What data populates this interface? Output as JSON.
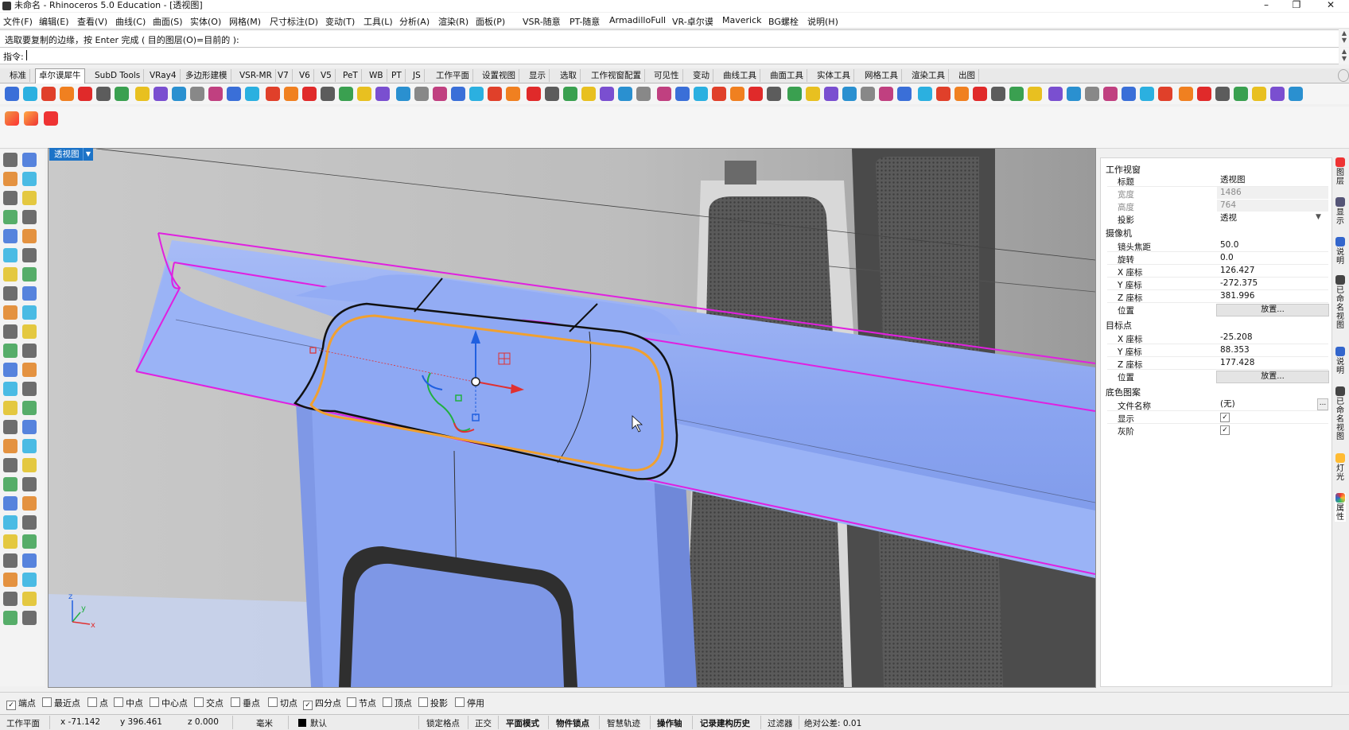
{
  "window": {
    "title": "未命名 - Rhinoceros 5.0 Education - [透视图]",
    "minimize": "–",
    "restore": "❐",
    "close": "✕"
  },
  "menu": [
    "文件(F)",
    "编辑(E)",
    "查看(V)",
    "曲线(C)",
    "曲面(S)",
    "实体(O)",
    "网格(M)",
    "尺寸标注(D)",
    "变动(T)",
    "工具(L)",
    "分析(A)",
    "渲染(R)",
    "面板(P)",
    "VSR-随意",
    "PT-随意",
    "ArmadilloFull",
    "VR-卓尔谟",
    "Maverick",
    "BG螺栓",
    "说明(H)"
  ],
  "command": {
    "prompt": "选取要复制的边缘，按 Enter 完成 ( 目的图层(O)=目前的 ):",
    "label": "指令:",
    "value": ""
  },
  "tabs": [
    "标准",
    "卓尔谟犀牛",
    "SubD Tools",
    "VRay4",
    "多边形建模",
    "VSR-MR",
    "V7",
    "V6",
    "V5",
    "PeT",
    "WB",
    "PT",
    "JS",
    "工作平面",
    "设置视图",
    "显示",
    "选取",
    "工作视窗配置",
    "可见性",
    "变动",
    "曲线工具",
    "曲面工具",
    "实体工具",
    "网格工具",
    "渲染工具",
    "出图"
  ],
  "active_tab": "卓尔谟犀牛",
  "viewport": {
    "label": "透视图",
    "axis_z": "z",
    "axis_y": "y",
    "axis_x": "x"
  },
  "properties": {
    "section_viewport": "工作视窗",
    "title_label": "标题",
    "title_value": "透视图",
    "width_label": "宽度",
    "width_value": "1486",
    "height_label": "高度",
    "height_value": "764",
    "projection_label": "投影",
    "projection_value": "透视",
    "section_camera": "摄像机",
    "lens_label": "镜头焦距",
    "lens_value": "50.0",
    "rotation_label": "旋转",
    "rotation_value": "0.0",
    "cam_x_label": "X 座标",
    "cam_x_value": "126.427",
    "cam_y_label": "Y 座标",
    "cam_y_value": "-272.375",
    "cam_z_label": "Z 座标",
    "cam_z_value": "381.996",
    "cam_pos_label": "位置",
    "cam_pos_button": "放置...",
    "section_target": "目标点",
    "tgt_x_label": "X 座标",
    "tgt_x_value": "-25.208",
    "tgt_y_label": "Y 座标",
    "tgt_y_value": "88.353",
    "tgt_z_label": "Z 座标",
    "tgt_z_value": "177.428",
    "tgt_pos_label": "位置",
    "tgt_pos_button": "放置...",
    "section_wallpaper": "底色图案",
    "file_label": "文件名称",
    "file_value": "(无)",
    "file_button": "...",
    "show_label": "显示",
    "show_checked": "✓",
    "gray_label": "灰阶",
    "gray_checked": "✓"
  },
  "right_tabs": [
    "图层",
    "显示",
    "说明",
    "已命名视图",
    "说明",
    "已命名视图",
    "灯光",
    "属性"
  ],
  "osnap": {
    "items": [
      {
        "label": "端点",
        "checked": "✓"
      },
      {
        "label": "最近点",
        "checked": ""
      },
      {
        "label": "点",
        "checked": ""
      },
      {
        "label": "中点",
        "checked": ""
      },
      {
        "label": "中心点",
        "checked": ""
      },
      {
        "label": "交点",
        "checked": ""
      },
      {
        "label": "垂点",
        "checked": ""
      },
      {
        "label": "切点",
        "checked": ""
      },
      {
        "label": "四分点",
        "checked": "✓"
      },
      {
        "label": "节点",
        "checked": ""
      },
      {
        "label": "顶点",
        "checked": ""
      },
      {
        "label": "投影",
        "checked": ""
      },
      {
        "label": "停用",
        "checked": ""
      }
    ]
  },
  "status": {
    "cplane": "工作平面",
    "x": "x -71.142",
    "y": "y 396.461",
    "z": "z 0.000",
    "units": "毫米",
    "layer": "默认",
    "grid_snap": "锁定格点",
    "ortho": "正交",
    "planar": "平面模式",
    "osnap": "物件锁点",
    "smarttrack": "智慧轨迹",
    "gumball": "操作轴",
    "history": "记录建构历史",
    "filter": "过滤器",
    "tolerance": "绝对公差: 0.01"
  },
  "colors": {
    "accent": "#1c73c7",
    "surface": "#8aa6f2",
    "selection_edge": "#e020e0",
    "curve": "#f0a030"
  }
}
